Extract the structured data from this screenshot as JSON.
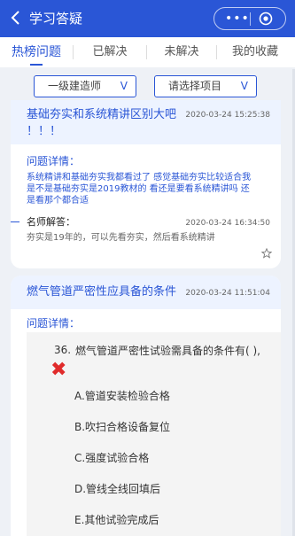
{
  "header": {
    "back_icon": "chevron-left-icon",
    "title": "学习答疑",
    "more_icon": "more-dots-icon",
    "target_icon": "target-icon"
  },
  "tabs": [
    {
      "label": "热榜问题",
      "active": true
    },
    {
      "label": "已解决",
      "active": false
    },
    {
      "label": "未解决",
      "active": false
    },
    {
      "label": "我的收藏",
      "active": false
    }
  ],
  "filters": {
    "left": "一级建造师",
    "right": "请选择项目",
    "arrow": "V"
  },
  "card1": {
    "title_line1": "基础夯实和系统精讲区别大吧",
    "title_line2": "！！！",
    "time": "2020-03-24  15:25:38",
    "detail_label": "问题详情：",
    "detail_line1": "系统精讲和基础夯实我都看过了 感觉基础夯实比较适合我",
    "detail_line2": "是不是基础夯实是2019教材的 看还是要看系统精讲吗 还",
    "detail_line3": "是看那个都合适",
    "answer_label": "名师解答：",
    "answer_time": "2020-03-24  16:34:50",
    "answer_text": "夯实是19年的，可以先看夯实，然后看系统精讲",
    "star_icon": "star-outline-icon"
  },
  "card2": {
    "title": "燃气管道严密性应具备的条件",
    "time": "2020-03-24  11:51:04",
    "detail_label": "问题详情：",
    "question_number": "36.",
    "question_text": "燃气管道严密性试验需具备的条件有(  ),",
    "wrong_icon": "x-mark-icon",
    "options": [
      "A.管道安装检验合格",
      "B.吹扫合格设备复位",
      "C.强度试验合格",
      "D.管线全线回填后",
      "E.其他试验完成后"
    ]
  }
}
